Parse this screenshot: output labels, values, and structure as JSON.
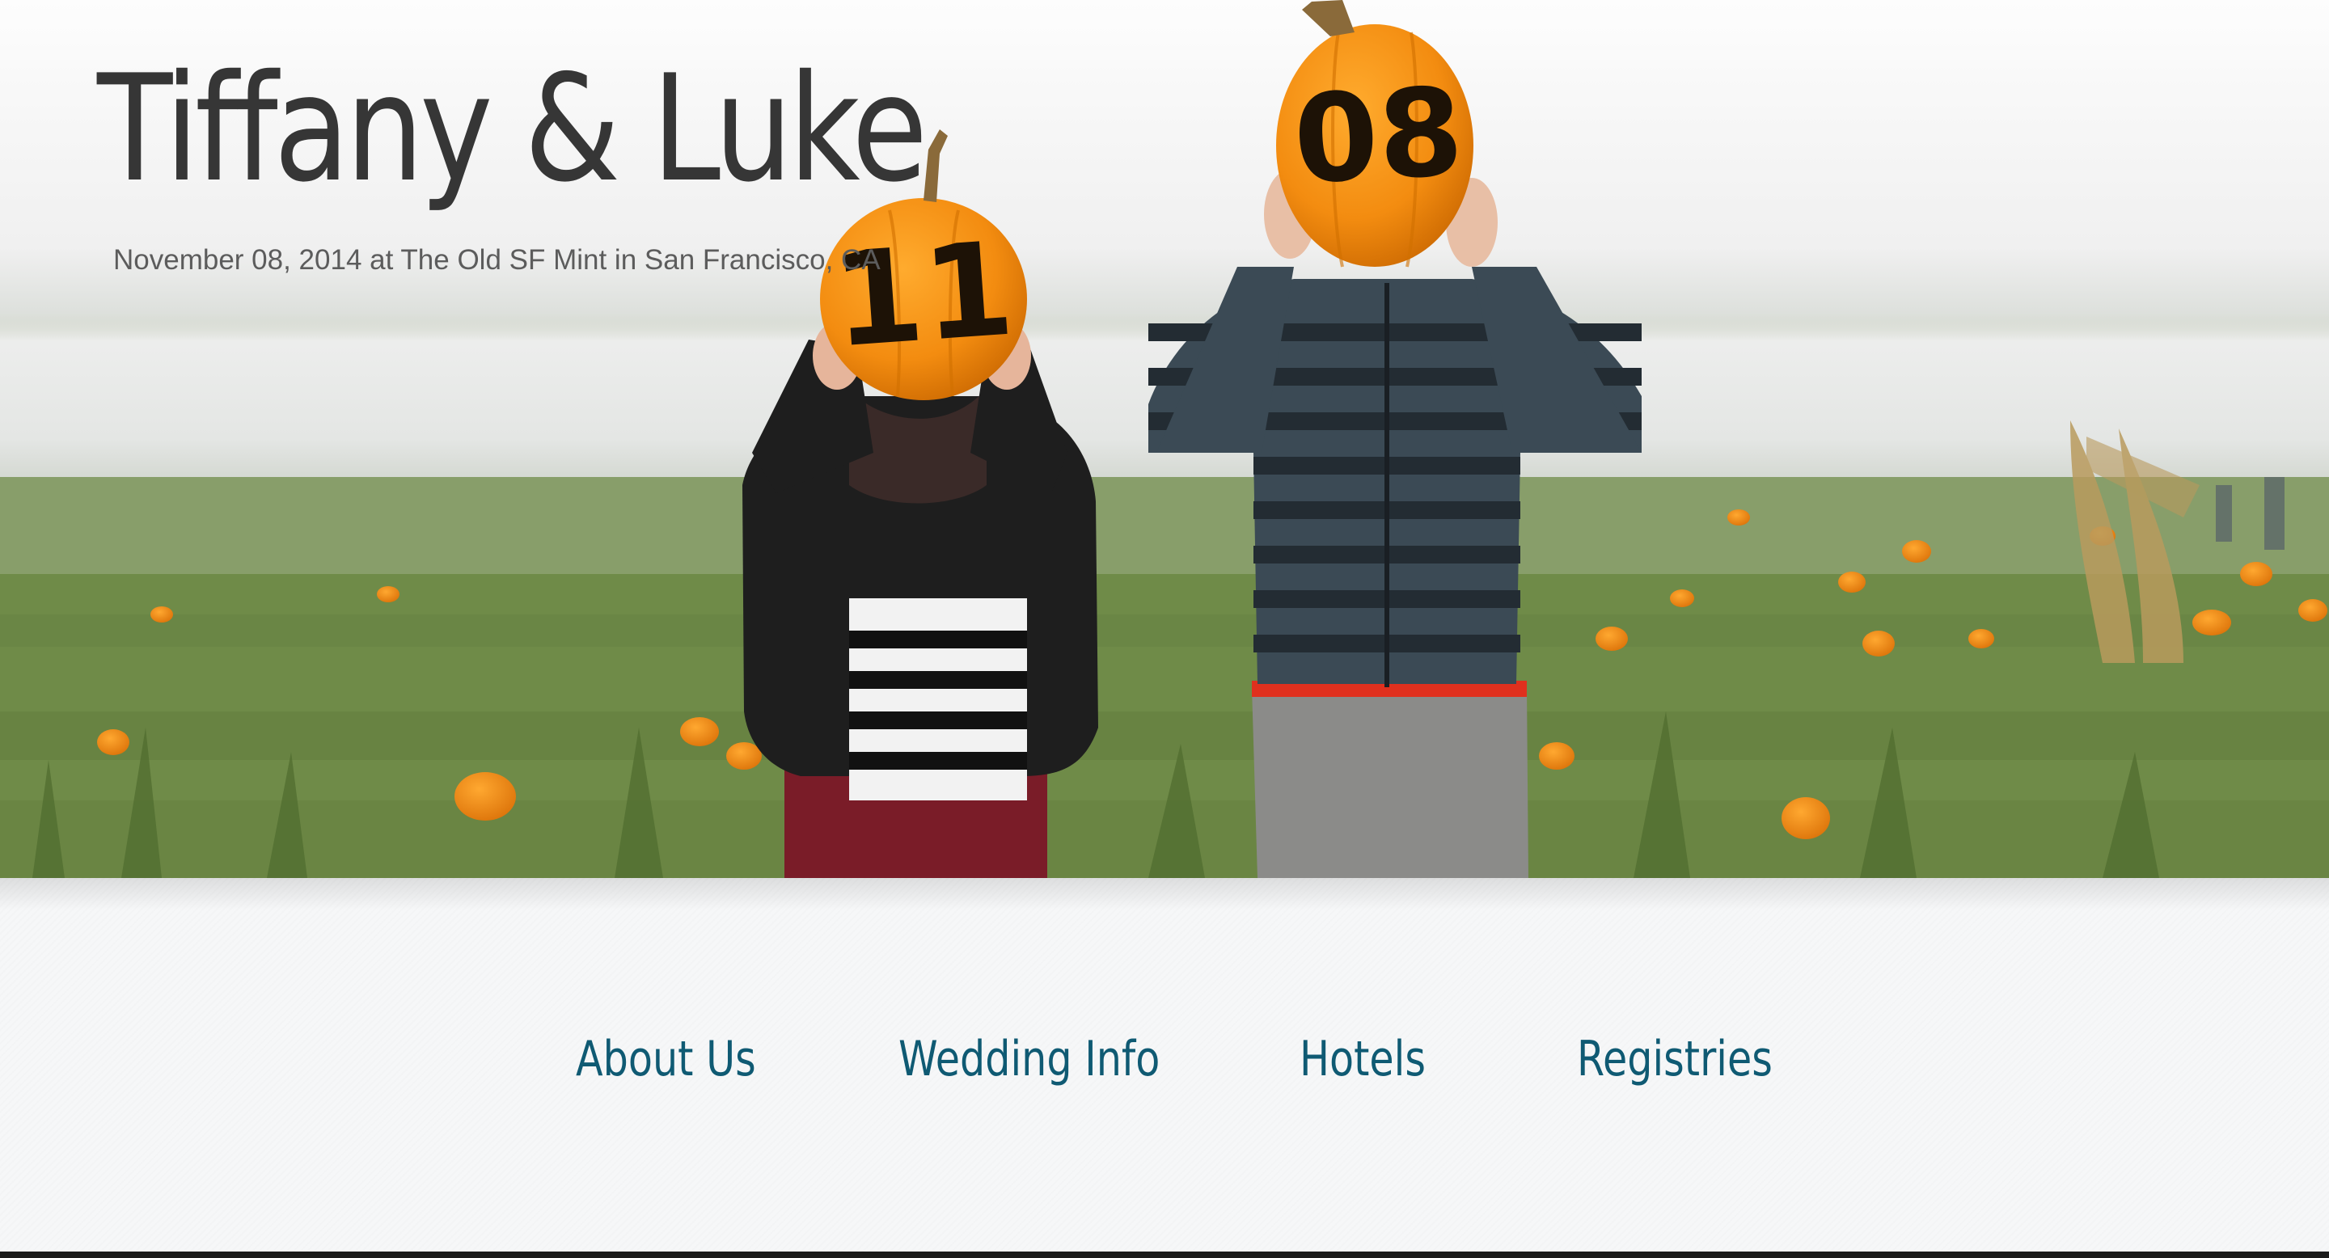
{
  "header": {
    "title": "Tiffany & Luke",
    "subtitle": "November 08, 2014 at The Old SF Mint in San Francisco, CA"
  },
  "hero_image": {
    "pumpkin_left_text": "11",
    "pumpkin_right_text": "08"
  },
  "nav": {
    "items": [
      {
        "label": "About Us"
      },
      {
        "label": "Wedding Info"
      },
      {
        "label": "Hotels"
      },
      {
        "label": "Registries"
      }
    ]
  },
  "colors": {
    "nav_link": "#0f5a73",
    "title": "#363636",
    "subtitle": "#5c5c5c",
    "background": "#f6f7f8"
  }
}
